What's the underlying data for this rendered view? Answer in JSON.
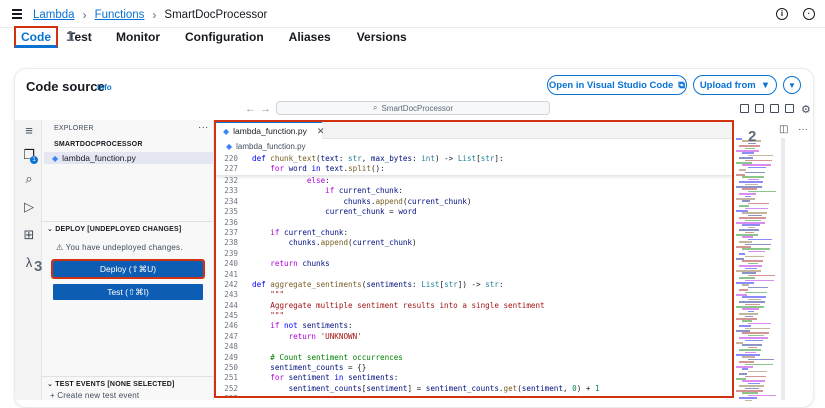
{
  "breadcrumb": {
    "items": [
      "Lambda",
      "Functions"
    ],
    "current": "SmartDocProcessor"
  },
  "tabs": [
    "Code",
    "Test",
    "Monitor",
    "Configuration",
    "Aliases",
    "Versions"
  ],
  "annotations": [
    "1",
    "2",
    "3"
  ],
  "code_source": {
    "title": "Code source",
    "info": "Info",
    "open_vscode": "Open in Visual Studio Code",
    "upload_from": "Upload from"
  },
  "search": {
    "text": "SmartDocProcessor"
  },
  "explorer": {
    "header": "EXPLORER",
    "project": "SMARTDOCPROCESSOR",
    "file": "lambda_function.py",
    "deploy_header": "DEPLOY [UNDEPLOYED CHANGES]",
    "warning": "You have undeployed changes.",
    "deploy_button": "Deploy (⇧⌘U)",
    "test_button": "Test (⇧⌘I)",
    "test_events_header": "TEST EVENTS [NONE SELECTED]",
    "create_event": "Create new test event"
  },
  "editor": {
    "tab": "lambda_function.py",
    "crumb": "lambda_function.py",
    "sticky": [
      {
        "n": "220",
        "text": "def chunk_text(text: str, max_bytes: int) -> List[str]:"
      },
      {
        "n": "227",
        "text": "    for word in text.split():"
      }
    ],
    "lines": [
      {
        "n": "232",
        "segs": [
          [
            "",
            "            "
          ],
          [
            "ctl",
            "else"
          ],
          [
            "",
            ":"
          ]
        ]
      },
      {
        "n": "233",
        "segs": [
          [
            "",
            "                "
          ],
          [
            "ctl",
            "if"
          ],
          [
            "",
            " "
          ],
          [
            "var",
            "current_chunk"
          ],
          [
            "",
            ":"
          ]
        ]
      },
      {
        "n": "234",
        "segs": [
          [
            "",
            "                    "
          ],
          [
            "var",
            "chunks"
          ],
          [
            "",
            "."
          ],
          [
            "fn",
            "append"
          ],
          [
            "",
            "("
          ],
          [
            "var",
            "current_chunk"
          ],
          [
            "",
            ")"
          ]
        ]
      },
      {
        "n": "235",
        "segs": [
          [
            "",
            "                "
          ],
          [
            "var",
            "current_chunk"
          ],
          [
            "",
            " = "
          ],
          [
            "var",
            "word"
          ]
        ]
      },
      {
        "n": "236",
        "segs": []
      },
      {
        "n": "237",
        "segs": [
          [
            "",
            "    "
          ],
          [
            "ctl",
            "if"
          ],
          [
            "",
            " "
          ],
          [
            "var",
            "current_chunk"
          ],
          [
            "",
            ":"
          ]
        ]
      },
      {
        "n": "238",
        "segs": [
          [
            "",
            "        "
          ],
          [
            "var",
            "chunks"
          ],
          [
            "",
            "."
          ],
          [
            "fn",
            "append"
          ],
          [
            "",
            "("
          ],
          [
            "var",
            "current_chunk"
          ],
          [
            "",
            ")"
          ]
        ]
      },
      {
        "n": "239",
        "segs": []
      },
      {
        "n": "240",
        "segs": [
          [
            "",
            "    "
          ],
          [
            "ctl",
            "return"
          ],
          [
            "",
            " "
          ],
          [
            "var",
            "chunks"
          ]
        ]
      },
      {
        "n": "241",
        "segs": []
      },
      {
        "n": "242",
        "segs": [
          [
            "kw",
            "def"
          ],
          [
            "",
            " "
          ],
          [
            "fn",
            "aggregate_sentiments"
          ],
          [
            "",
            "("
          ],
          [
            "var",
            "sentiments"
          ],
          [
            "",
            ": "
          ],
          [
            "ty",
            "List"
          ],
          [
            "",
            "["
          ],
          [
            "ty",
            "str"
          ],
          [
            "",
            "]) -> "
          ],
          [
            "ty",
            "str"
          ],
          [
            "",
            ":"
          ]
        ]
      },
      {
        "n": "243",
        "segs": [
          [
            "",
            "    "
          ],
          [
            "str",
            "\"\"\""
          ]
        ]
      },
      {
        "n": "244",
        "segs": [
          [
            "",
            "    "
          ],
          [
            "str",
            "Aggregate multiple sentiment results into a single sentiment"
          ]
        ]
      },
      {
        "n": "245",
        "segs": [
          [
            "",
            "    "
          ],
          [
            "str",
            "\"\"\""
          ]
        ]
      },
      {
        "n": "246",
        "segs": [
          [
            "",
            "    "
          ],
          [
            "ctl",
            "if"
          ],
          [
            "",
            " "
          ],
          [
            "kw",
            "not"
          ],
          [
            "",
            " "
          ],
          [
            "var",
            "sentiments"
          ],
          [
            "",
            ":"
          ]
        ]
      },
      {
        "n": "247",
        "segs": [
          [
            "",
            "        "
          ],
          [
            "ctl",
            "return"
          ],
          [
            "",
            " "
          ],
          [
            "str",
            "'UNKNOWN'"
          ]
        ]
      },
      {
        "n": "248",
        "segs": []
      },
      {
        "n": "249",
        "segs": [
          [
            "",
            "    "
          ],
          [
            "cm",
            "# Count sentiment occurrences"
          ]
        ]
      },
      {
        "n": "250",
        "segs": [
          [
            "",
            "    "
          ],
          [
            "var",
            "sentiment_counts"
          ],
          [
            "",
            " = {}"
          ]
        ]
      },
      {
        "n": "251",
        "segs": [
          [
            "",
            "    "
          ],
          [
            "ctl",
            "for"
          ],
          [
            "",
            " "
          ],
          [
            "var",
            "sentiment"
          ],
          [
            "",
            " "
          ],
          [
            "kw",
            "in"
          ],
          [
            "",
            " "
          ],
          [
            "var",
            "sentiments"
          ],
          [
            "",
            ":"
          ]
        ]
      },
      {
        "n": "252",
        "segs": [
          [
            "",
            "        "
          ],
          [
            "var",
            "sentiment_counts"
          ],
          [
            "",
            "["
          ],
          [
            "var",
            "sentiment"
          ],
          [
            "",
            "] = "
          ],
          [
            "var",
            "sentiment_counts"
          ],
          [
            "",
            "."
          ],
          [
            "fn",
            "get"
          ],
          [
            "",
            "("
          ],
          [
            "var",
            "sentiment"
          ],
          [
            "",
            ", "
          ],
          [
            "num",
            "0"
          ],
          [
            "",
            ") + "
          ],
          [
            "num",
            "1"
          ]
        ]
      },
      {
        "n": "253",
        "segs": []
      }
    ]
  },
  "colors": {
    "accent": "#0972d3",
    "highlight_border": "#d13212",
    "button_bg": "#0e5db5"
  }
}
